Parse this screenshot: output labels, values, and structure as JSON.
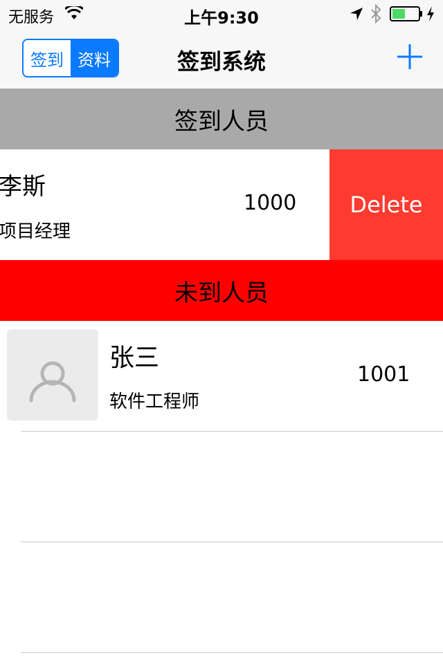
{
  "status_bar": {
    "carrier": "无服务",
    "time": "上午9:30"
  },
  "nav": {
    "segments": [
      "签到",
      "资料"
    ],
    "selected_segment": "资料",
    "title": "签到系统",
    "add_icon": "plus-icon"
  },
  "sections": {
    "checked_in": "签到人员",
    "not_checked_in": "未到人员"
  },
  "checked_list": [
    {
      "name": "李斯",
      "title": "项目经理",
      "number": "1000",
      "delete_label": "Delete"
    }
  ],
  "unchecked_list": [
    {
      "name": "张三",
      "title": "软件工程师",
      "number": "1001",
      "avatar_icon": "person-placeholder-icon"
    }
  ],
  "colors": {
    "accent": "#0a7aff",
    "checked_header": "#a9a9a9",
    "unchecked_header": "#ff0000",
    "delete": "#ff3b30"
  }
}
